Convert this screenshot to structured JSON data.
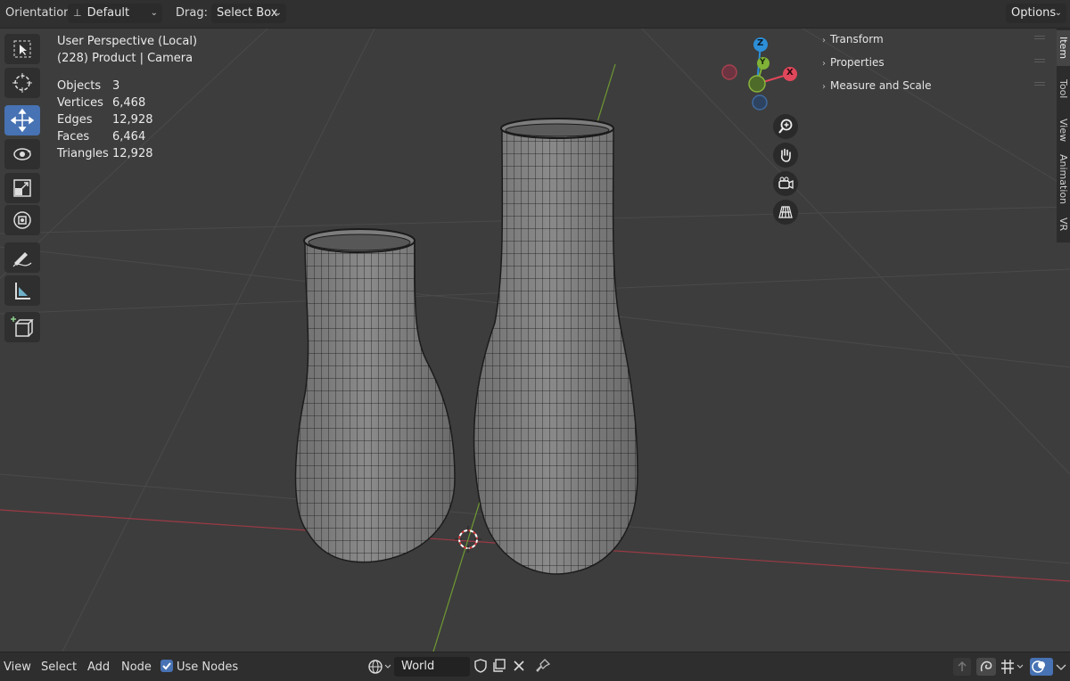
{
  "header": {
    "orientation_label": "Orientation:",
    "orientation_value": "Default",
    "drag_label": "Drag:",
    "drag_value": "Select Box",
    "options_label": "Options"
  },
  "viewport": {
    "perspective": "User Perspective (Local)",
    "context": "(228) Product | Camera",
    "stats": [
      {
        "label": "Objects",
        "value": "3"
      },
      {
        "label": "Vertices",
        "value": "6,468"
      },
      {
        "label": "Edges",
        "value": "12,928"
      },
      {
        "label": "Faces",
        "value": "6,464"
      },
      {
        "label": "Triangles",
        "value": "12,928"
      }
    ],
    "gizmo": {
      "z": "Z",
      "y": "Y",
      "x": "X"
    }
  },
  "toolbar": {
    "tools": [
      "select-box-icon",
      "cursor-icon",
      "move-icon",
      "rotate-icon",
      "scale-icon",
      "transform-icon",
      "annotate-icon",
      "measure-icon",
      "add-cube-icon"
    ],
    "active": "move-icon"
  },
  "side_panel": {
    "sections": [
      "Transform",
      "Properties",
      "Measure and Scale"
    ],
    "tabs": [
      "Item",
      "Tool",
      "View",
      "Animation",
      "VR"
    ]
  },
  "footer": {
    "menus": [
      "View",
      "Select",
      "Add",
      "Node"
    ],
    "use_nodes_label": "Use Nodes",
    "use_nodes_checked": true,
    "world_name": "World"
  },
  "colors": {
    "accent": "#4772b3",
    "x_axis": "#e0475a",
    "y_axis": "#7fb236",
    "z_axis": "#2c8fd8"
  }
}
